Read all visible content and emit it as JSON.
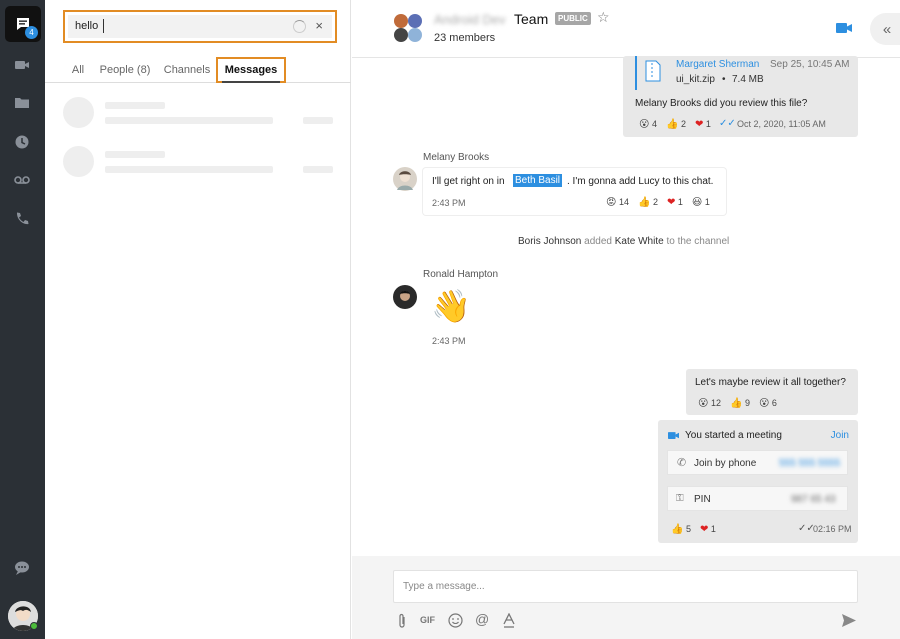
{
  "rail": {
    "badge_count": "4",
    "items": [
      "chat-icon",
      "video-icon",
      "folder-icon",
      "clock-icon",
      "voicemail-icon",
      "phone-icon",
      "feedback-icon"
    ]
  },
  "search": {
    "value": "hello",
    "clear": "×",
    "tabs": [
      "All",
      "People (8)",
      "Channels",
      "Messages"
    ],
    "active_tab": "Messages"
  },
  "header": {
    "title_blurred": "Android Dev",
    "title": "Team",
    "badge": "PUBLIC",
    "members": "23 members"
  },
  "messages": {
    "file_card": {
      "sender": "Margaret Sherman",
      "time": "Sep 25, 10:45 AM",
      "file_name": "ui_kit.zip",
      "separator": "•",
      "file_size": "7.4 MB",
      "text": "Melany Brooks did you review this file?",
      "reactions": [
        {
          "emoji": "😮",
          "count": "4"
        },
        {
          "emoji": "👍",
          "count": "2"
        },
        {
          "emoji": "❤",
          "count": "1"
        }
      ],
      "timestamp": "Oct 2, 2020, 11:05 AM"
    },
    "melany": {
      "name": "Melany Brooks",
      "text_before": "I'll get right on in",
      "mention": "Beth Basil",
      "text_after": ". I'm gonna add Lucy to this chat.",
      "time": "2:43 PM",
      "reactions": [
        {
          "emoji": "😡",
          "count": "14"
        },
        {
          "emoji": "👍",
          "count": "2"
        },
        {
          "emoji": "❤",
          "count": "1"
        },
        {
          "emoji": "😃",
          "count": "1"
        }
      ]
    },
    "system": {
      "actor": "Boris Johnson",
      "verb": "added",
      "target": "Kate White",
      "suffix": "to the channel"
    },
    "ronald": {
      "name": "Ronald Hampton",
      "emoji": "👋",
      "time": "2:43 PM"
    },
    "mine": {
      "text": "Let's maybe review it all together?",
      "reactions": [
        {
          "emoji": "😮",
          "count": "12"
        },
        {
          "emoji": "👍",
          "count": "9"
        },
        {
          "emoji": "😮",
          "count": "6"
        }
      ]
    },
    "meeting": {
      "title": "You started a meeting",
      "join": "Join",
      "phone_label": "Join by phone",
      "phone_value": "555 555 5555",
      "pin_label": "PIN",
      "pin_value": "987 65 43",
      "reactions": [
        {
          "emoji": "👍",
          "count": "5"
        },
        {
          "emoji": "❤",
          "count": "1"
        }
      ],
      "time": "02:16 PM"
    }
  },
  "composer": {
    "placeholder": "Type a message..."
  },
  "colors": {
    "accent": "#2d8fe0",
    "highlight": "#e28c24",
    "rail": "#2b3036"
  }
}
